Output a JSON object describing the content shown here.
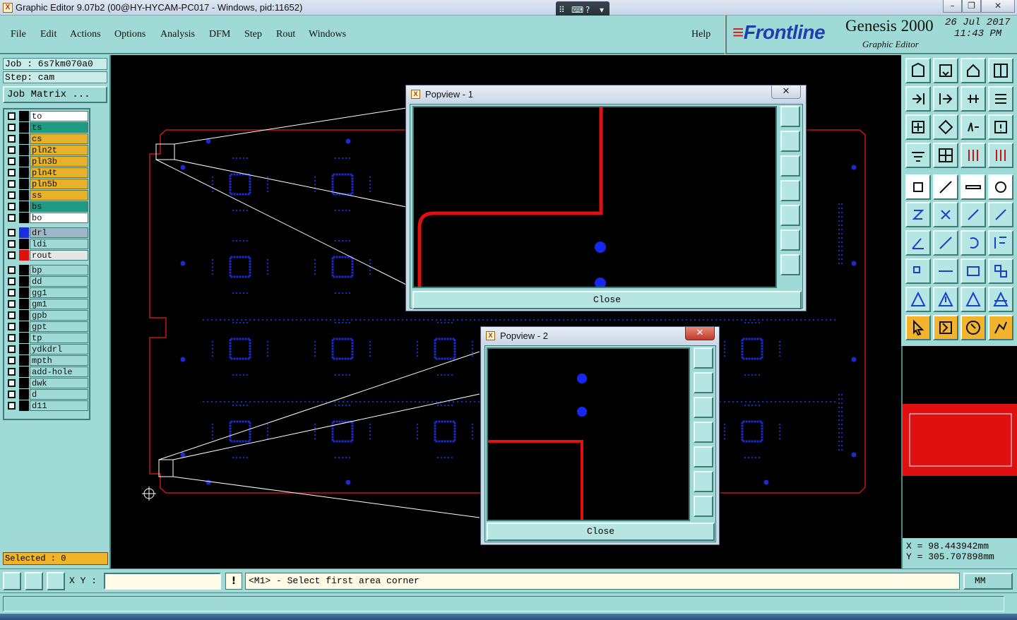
{
  "window": {
    "title": "Graphic Editor 9.07b2 (00@HY-HYCAM-PC017 - Windows, pid:11652)",
    "icon": "app-x-icon",
    "controls": [
      "minimize-icon",
      "restore-icon",
      "close-icon"
    ]
  },
  "menu": {
    "items": [
      "File",
      "Edit",
      "Actions",
      "Options",
      "Analysis",
      "DFM",
      "Step",
      "Rout",
      "Windows"
    ],
    "help": "Help"
  },
  "brand": {
    "logo": "Frontline",
    "product": "Genesis 2000",
    "subtitle": "Graphic Editor",
    "date": "26 Jul 2017",
    "time": "11:43 PM"
  },
  "job": {
    "job_line": "Job : 6s7km070a0",
    "step_line": "Step: cam",
    "matrix_button": "Job Matrix ..."
  },
  "layers": {
    "group1": [
      {
        "name": "to",
        "color": "#ffffff"
      },
      {
        "name": "ts",
        "color": "#1e9b82"
      },
      {
        "name": "cs",
        "color": "#e8b12a"
      },
      {
        "name": "pln2t",
        "color": "#e8b12a"
      },
      {
        "name": "pln3b",
        "color": "#e8b12a"
      },
      {
        "name": "pln4t",
        "color": "#e8b12a"
      },
      {
        "name": "pln5b",
        "color": "#e8b12a"
      },
      {
        "name": "ss",
        "color": "#e8b12a"
      },
      {
        "name": "bs",
        "color": "#1e9b82"
      },
      {
        "name": "bo",
        "color": "#ffffff"
      }
    ],
    "group2": [
      {
        "name": "drl",
        "color": "#9fb5c8",
        "swatch": "#1a2ee0"
      },
      {
        "name": "ldi",
        "color": "#9fdad7",
        "swatch": ""
      },
      {
        "name": "rout",
        "color": "#e6e6e6",
        "swatch": "#e01010"
      }
    ],
    "group3": [
      {
        "name": "bp"
      },
      {
        "name": "dd"
      },
      {
        "name": "gg1"
      },
      {
        "name": "gm1"
      },
      {
        "name": "gpb"
      },
      {
        "name": "gpt"
      },
      {
        "name": "tp"
      },
      {
        "name": "ydkdrl"
      },
      {
        "name": "mpth"
      },
      {
        "name": "add-hole"
      },
      {
        "name": "dwk"
      },
      {
        "name": "d"
      },
      {
        "name": "d11"
      }
    ],
    "selected": "Selected : 0"
  },
  "popviews": [
    {
      "title": "Popview - 1",
      "close_label": "Close"
    },
    {
      "title": "Popview - 2",
      "close_label": "Close"
    }
  ],
  "bottom": {
    "xy_label": "X Y :",
    "xy_value": "",
    "prompt": "<M1> - Select first area corner",
    "unit": "MM"
  },
  "coords": {
    "x": "X = 98.443942mm",
    "y": "Y = 305.707898mm"
  },
  "colors": {
    "panel": "#9fdad7",
    "rout": "#e01010",
    "drill": "#1a2ee0"
  }
}
